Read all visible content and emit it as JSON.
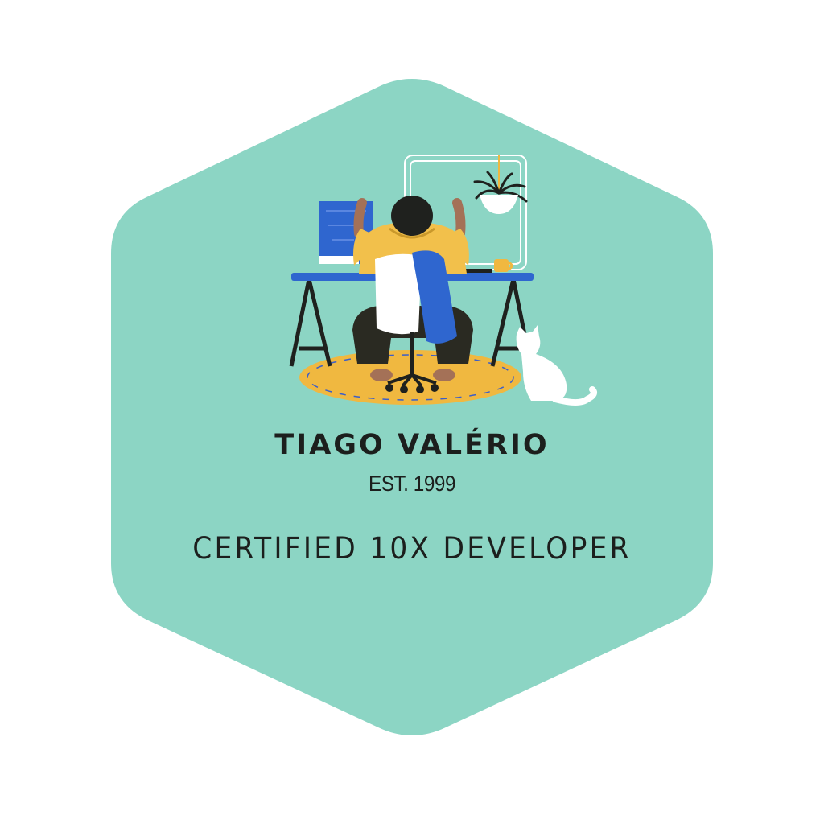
{
  "badge": {
    "shape": "hexagon",
    "background_color": "#8cd5c4",
    "name": "TIAGO VALÉRIO",
    "established": "EST. 1999",
    "certification": "CERTIFIED 10X DEVELOPER"
  },
  "illustration": {
    "subject": "developer-at-desk",
    "colors": {
      "monitor": "#2f66cf",
      "hoodie": "#f2c04b",
      "pants": "#2a2a22",
      "rug": "#f0b840",
      "desk": "#2f66cf",
      "scarf": "#2f66cf",
      "chair": "#ffffff",
      "cat": "#ffffff",
      "skin": "#a47157"
    }
  }
}
